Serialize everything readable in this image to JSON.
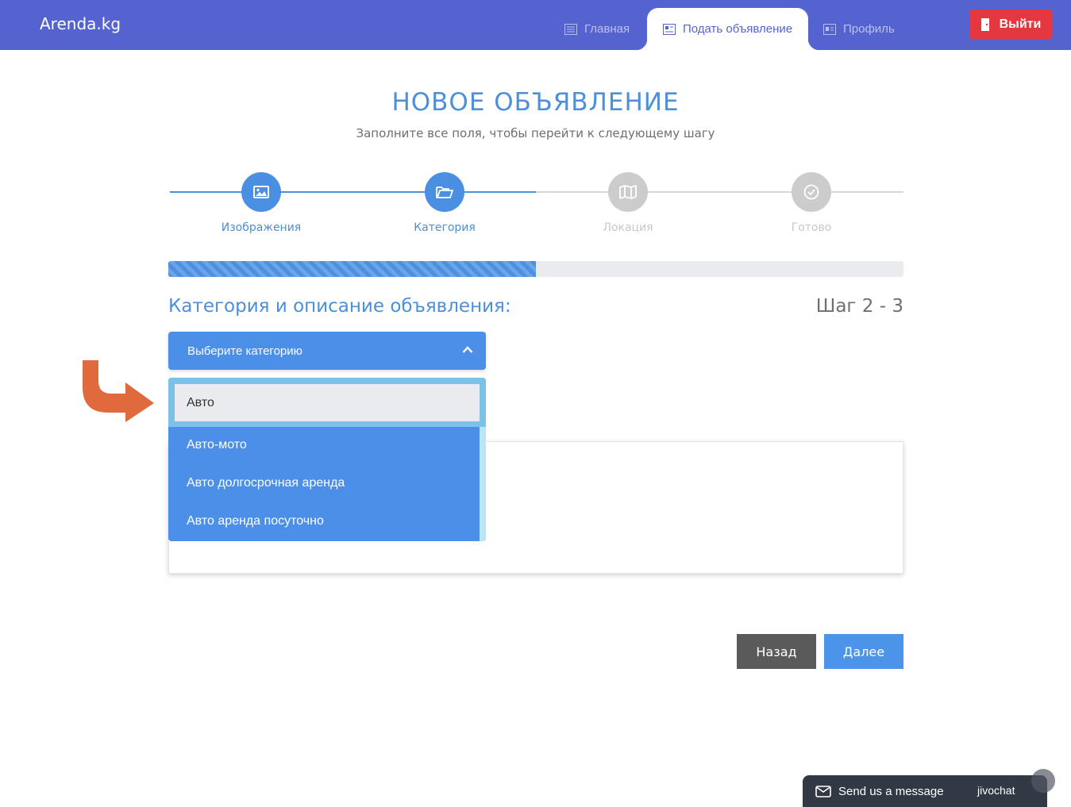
{
  "header": {
    "logo": "Arenda.kg",
    "nav": [
      {
        "label": "Главная",
        "icon": "newspaper-icon"
      },
      {
        "label": "Подать объявление",
        "icon": "newspaper-icon"
      },
      {
        "label": "Профиль",
        "icon": "id-card-icon"
      }
    ],
    "logout_label": "Выйти",
    "colors": {
      "bar": "#5463cf",
      "logout": "#e4373f"
    }
  },
  "page": {
    "title": "НОВОЕ ОБЪЯВЛЕНИЕ",
    "subtitle": "Заполните все поля, чтобы перейти к следующему шагу"
  },
  "steps": [
    {
      "label": "Изображения",
      "icon": "image-icon",
      "state": "done"
    },
    {
      "label": "Категория",
      "icon": "folder-open-icon",
      "state": "active"
    },
    {
      "label": "Локация",
      "icon": "map-icon",
      "state": "pending"
    },
    {
      "label": "Готово",
      "icon": "check-circle-icon",
      "state": "pending"
    }
  ],
  "progress": {
    "percent": 50
  },
  "form": {
    "section_title": "Категория и описание объявления:",
    "step_counter": "Шаг 2 - 3",
    "select": {
      "label": "Выберите категорию"
    },
    "options": [
      "Авто",
      "Авто-мото",
      "Авто долгосрочная аренда",
      "Авто аренда посуточно"
    ],
    "highlighted_option": "Авто"
  },
  "buttons": {
    "back": "Назад",
    "next": "Далее"
  },
  "chat": {
    "label": "Send us a message",
    "brand": "jivochat"
  }
}
